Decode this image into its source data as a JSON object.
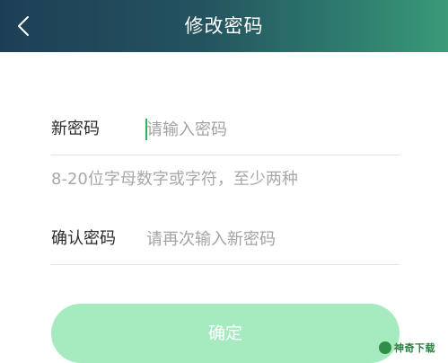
{
  "header": {
    "title": "修改密码",
    "back_icon": "chevron-left-icon",
    "gradient_colors": [
      "#1d3f56",
      "#3b9a78"
    ]
  },
  "form": {
    "new_password": {
      "label": "新密码",
      "placeholder": "请输入密码"
    },
    "hint": "8-20位字母数字或字符，至少两种",
    "confirm_password": {
      "label": "确认密码",
      "placeholder": "请再次输入新密码"
    }
  },
  "confirm_button": {
    "label": "确定",
    "color": "#a6ebbf"
  },
  "watermark": {
    "text": "神奇下载"
  }
}
